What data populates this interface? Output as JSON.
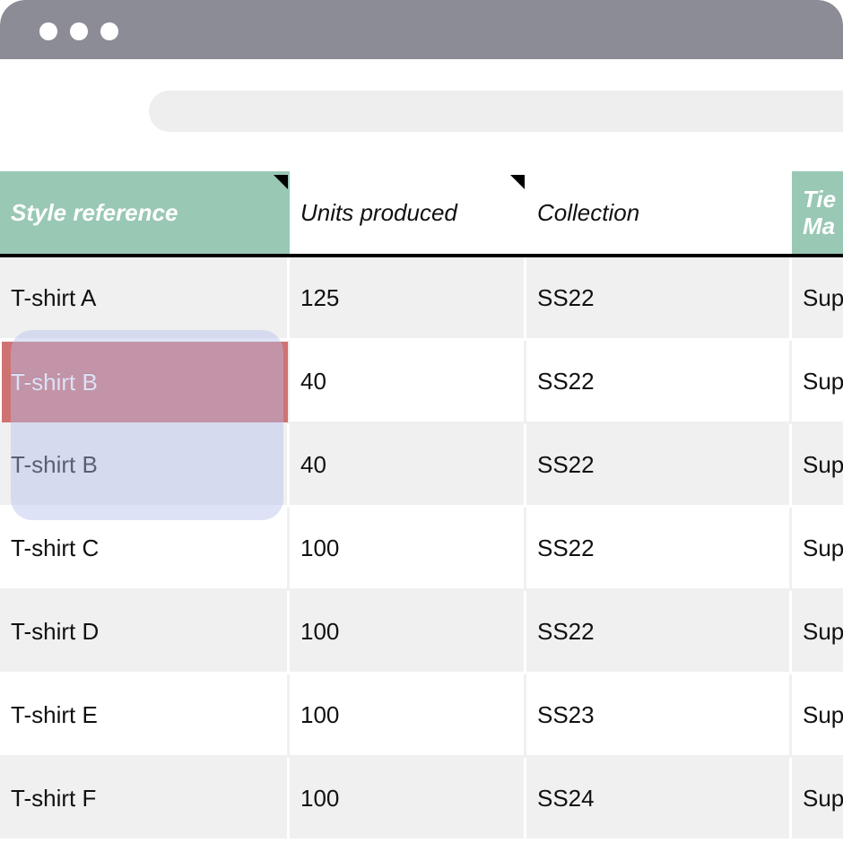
{
  "window": {
    "dots": [
      "dot-1",
      "dot-2",
      "dot-3"
    ]
  },
  "table": {
    "headers": {
      "style_reference": "Style reference",
      "units_produced": "Units produced",
      "collection": "Collection",
      "tier_line1": "Tie",
      "tier_line2": "Ma"
    },
    "rows": [
      {
        "style": "T-shirt A",
        "units": "125",
        "collection": "SS22",
        "tier": "Sup"
      },
      {
        "style": "T-shirt B",
        "units": "40",
        "collection": "SS22",
        "tier": "Sup"
      },
      {
        "style": "T-shirt B",
        "units": "40",
        "collection": "SS22",
        "tier": "Sup"
      },
      {
        "style": "T-shirt C",
        "units": "100",
        "collection": "SS22",
        "tier": "Sup"
      },
      {
        "style": "T-shirt D",
        "units": "100",
        "collection": "SS22",
        "tier": "Sup"
      },
      {
        "style": "T-shirt E",
        "units": "100",
        "collection": "SS23",
        "tier": "Sup"
      },
      {
        "style": "T-shirt F",
        "units": "100",
        "collection": "SS24",
        "tier": "Sup"
      }
    ]
  },
  "highlight": {
    "red_label": "T-shirt B"
  },
  "colors": {
    "titlebar": "#8c8c96",
    "header_green": "#99c8b5",
    "row_alt": "#f0f0f0",
    "highlight_red": "#c85f5f",
    "drag_ghost": "#b4beeb"
  }
}
